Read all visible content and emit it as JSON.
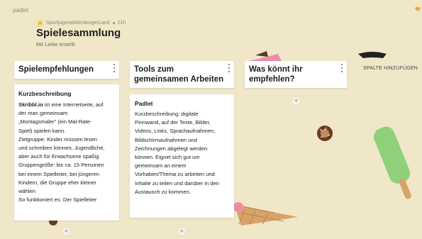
{
  "app": {
    "brand": "padlet"
  },
  "header": {
    "author": "SportjugendAltenburgerLand",
    "time": "21h",
    "title": "Spielesammlung",
    "subtitle": "Mit Liebe erstellt"
  },
  "columns": [
    {
      "title": "Spielempfehlungen",
      "cards": [
        {
          "title": "Kurzbeschreibung",
          "lines": [
            {
              "bold": "Skribbl.io",
              "rest": " ist eine Internetseite, auf"
            },
            {
              "text": "der man gemeinsam"
            },
            {
              "text": "„Montagsmaler“ (ein Mal-Rate-"
            },
            {
              "text": "Spiel) spielen kann."
            },
            {
              "text": "Zielgruppe: Kinder müssen lesen"
            },
            {
              "text": "und schreiben können, Jugendliche,"
            },
            {
              "text": "aber auch für Erwachsene spaßig"
            },
            {
              "text": "Gruppengröße: bis ca. 15 Personen"
            },
            {
              "text": "bei einem Spielleiter, bei jüngeren"
            },
            {
              "text": "Kindern, die Gruppe eher kleiner"
            },
            {
              "text": "wählen"
            },
            {
              "text": "So funktioniert es: Der Spielleiter"
            }
          ]
        }
      ],
      "add": "+"
    },
    {
      "title_line1": "Tools zum",
      "title_line2": "gemeinsamen Arbeiten",
      "cards": [
        {
          "title": "Padlet",
          "lines": [
            "Kurzbeschreibung: digitale",
            "Pinnwand, auf der Texte, Bilder,",
            "Videos, Links, Sprachaufnahmen,",
            "Bildschirmaufnahmen und",
            "Zeichnungen abgelegt werden",
            "können. Eignet sich gut um",
            "gemeinsam an einem",
            "Vorhaben/Thema zu arbeiten und",
            "Inhalte zu teilen und darüber in den",
            "Austausch zu kommen."
          ]
        }
      ],
      "add": "+"
    },
    {
      "title_line1": "Was könnt ihr",
      "title_line2": "empfehlen?",
      "cards": [],
      "add": "+"
    }
  ],
  "add_column_label": "SPALTE HINZUFÜGEN",
  "colors": {
    "background": "#efe7c8",
    "popsicle_green": "#8ed17a",
    "pink": "#f08aa6",
    "cone": "#d8a36a",
    "chocolate": "#6b3b1f"
  },
  "icons": [
    "heart-icon",
    "kebab-menu-icon",
    "plus-icon",
    "avatar-icon"
  ]
}
